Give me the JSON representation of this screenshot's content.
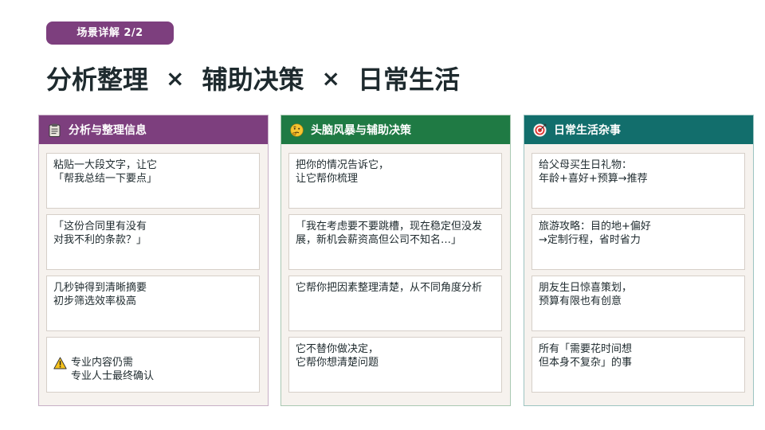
{
  "badge": "场景详解 2/2",
  "title": {
    "part1": "分析整理",
    "sep": "×",
    "part2": "辅助决策",
    "part3": "日常生活"
  },
  "columns": [
    {
      "header": "分析与整理信息",
      "icon": "clipboard-icon",
      "color": "#7d3f7e",
      "cards": [
        "粘贴一大段文字，让它\n「帮我总结一下要点」",
        "「这份合同里有没有\n对我不利的条款？」",
        "几秒钟得到清晰摘要\n初步筛选效率极高",
        "专业内容仍需\n专业人士最终确认"
      ]
    },
    {
      "header": "头脑风暴与辅助决策",
      "icon": "thinking-face-icon",
      "color": "#1f7a44",
      "cards": [
        "把你的情况告诉它，\n让它帮你梳理",
        "「我在考虑要不要跳槽，现在稳定但没发展，新机会薪资高但公司不知名…」",
        "它帮你把因素整理清楚，从不同角度分析",
        "它不替你做决定，\n它帮你想清楚问题"
      ]
    },
    {
      "header": "日常生活杂事",
      "icon": "target-icon",
      "color": "#126e6c",
      "cards": [
        "给父母买生日礼物：\n年龄+喜好+预算→推荐",
        "旅游攻略：目的地+偏好\n→定制行程，省时省力",
        "朋友生日惊喜策划，\n预算有限也有创意",
        "所有「需要花时间想\n但本身不复杂」的事"
      ]
    }
  ]
}
